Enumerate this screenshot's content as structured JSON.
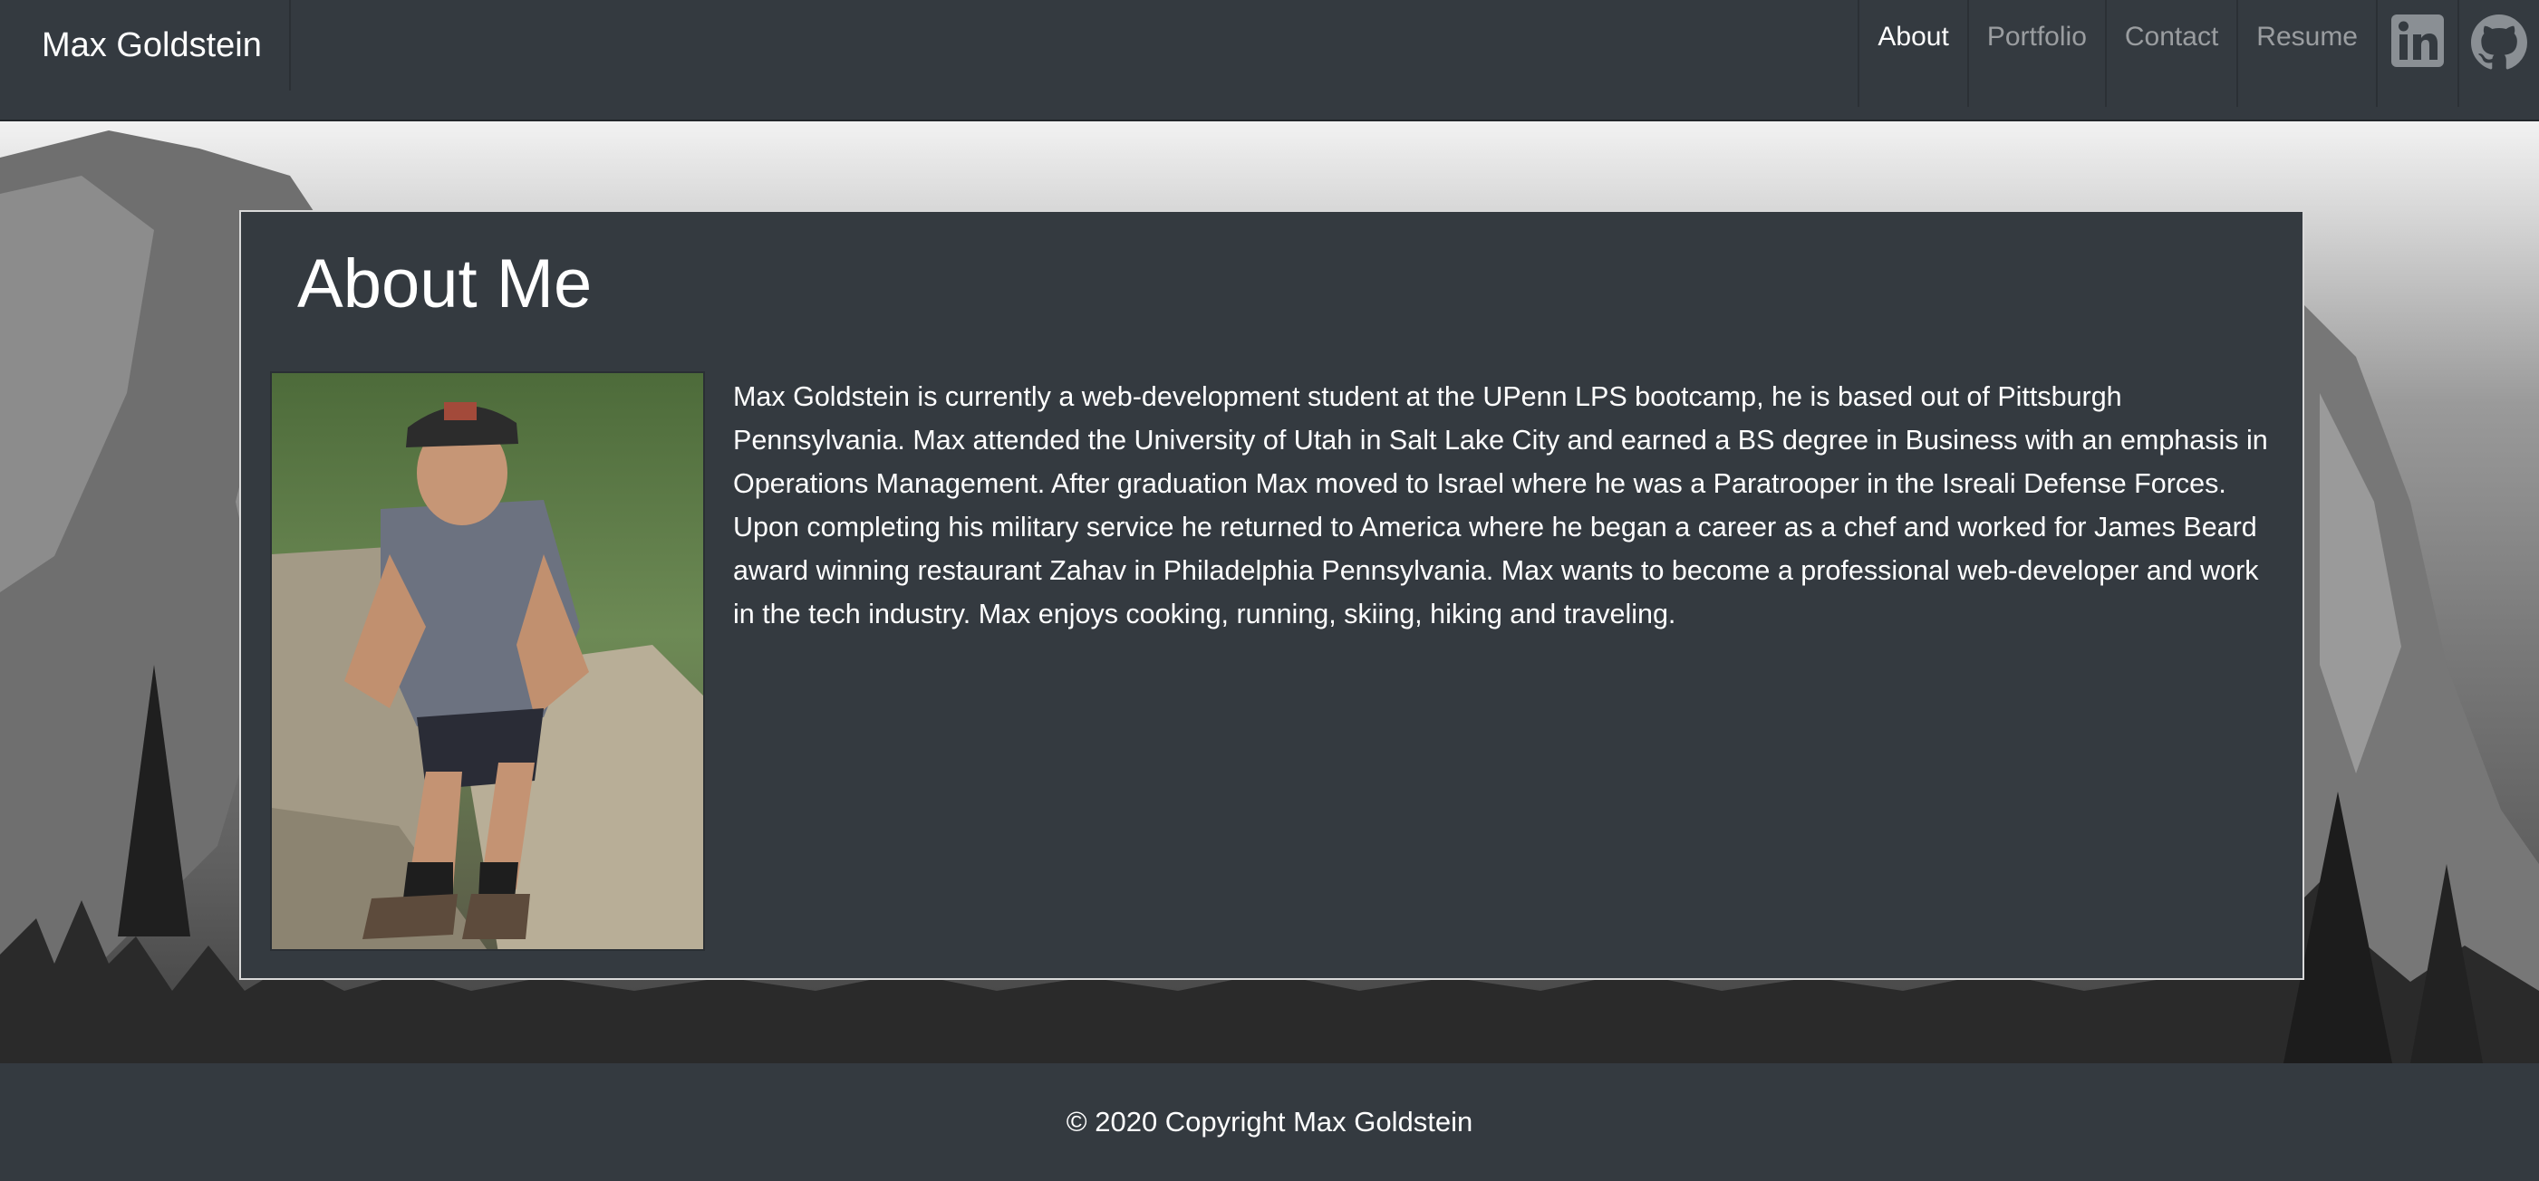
{
  "navbar": {
    "brand": "Max Goldstein",
    "links": [
      {
        "label": "About",
        "active": true
      },
      {
        "label": "Portfolio",
        "active": false
      },
      {
        "label": "Contact",
        "active": false
      },
      {
        "label": "Resume",
        "active": false
      }
    ],
    "icons": [
      "linkedin-icon",
      "github-icon"
    ]
  },
  "about": {
    "title": "About Me",
    "bio": "Max Goldstein is currently a web-development student at the UPenn LPS bootcamp, he is based out of Pittsburgh Pennsylvania. Max attended the University of Utah in Salt Lake City and earned a BS degree in Business with an emphasis in Operations Management. After graduation Max moved to Israel where he was a Paratrooper in the Isreali Defense Forces. Upon completing his military service he returned to America where he began a career as a chef and worked for James Beard award winning restaurant Zahav in Philadelphia Pennsylvania. Max wants to become a professional web-developer and work in the tech industry. Max enjoys cooking, running, skiing, hiking and traveling."
  },
  "footer": {
    "copyright": "© 2020 Copyright Max Goldstein"
  },
  "colors": {
    "dark": "#343a40",
    "text": "#ffffff",
    "nav_muted": "rgba(255,255,255,0.5)"
  }
}
